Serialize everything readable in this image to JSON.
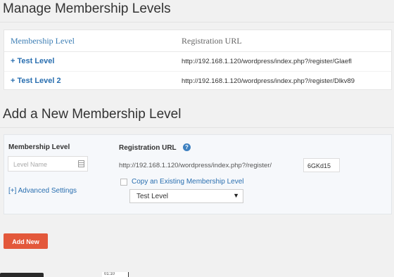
{
  "manage": {
    "title": "Manage Membership Levels",
    "columns": {
      "level": "Membership Level",
      "url": "Registration URL"
    },
    "rows": [
      {
        "name": "+ Test Level",
        "url": "http://192.168.1.120/wordpress/index.php?/register/Glaefl"
      },
      {
        "name": "+ Test Level 2",
        "url": "http://192.168.1.120/wordpress/index.php?/register/Dlkv89"
      }
    ]
  },
  "add_new": {
    "title": "Add a New Membership Level",
    "level_label": "Membership Level",
    "level_placeholder": "Level Name",
    "url_label": "Registration URL",
    "help_glyph": "?",
    "url_prefix": "http://192.168.1.120/wordpress/index.php?/register/",
    "url_code": "6GKd15",
    "advanced_link": "[+] Advanced Settings",
    "copy_label": "Copy an Existing Membership Level",
    "copy_select_value": "Test Level",
    "submit_label": "Add New"
  },
  "footer": {
    "fragment_text": "01:10"
  },
  "colors": {
    "link": "#2a6fb0",
    "button": "#e3583b",
    "help": "#3d80c0"
  },
  "icons": [
    "help-icon",
    "list-icon",
    "dropdown-arrow-icon"
  ]
}
